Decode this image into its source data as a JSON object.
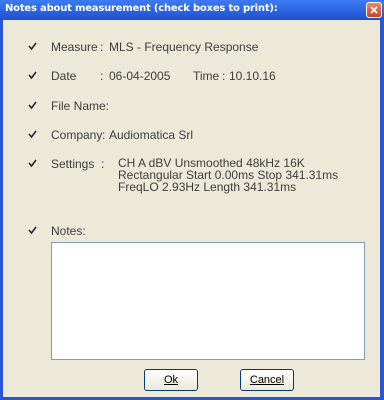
{
  "window": {
    "title": "Notes about measurement (check boxes to print):"
  },
  "fields": {
    "measure": {
      "label": "Measure",
      "value": "MLS - Frequency Response",
      "checked": true
    },
    "date": {
      "label": "Date",
      "value": "06-04-2005",
      "time_label": "Time",
      "time_value": "10.10.16",
      "checked": true
    },
    "file_name": {
      "label": "File Name:",
      "checked": true
    },
    "company": {
      "label": "Company",
      "value": "Audiomatica Srl",
      "checked": true
    },
    "settings": {
      "label": "Settings",
      "lines": [
        "CH A   dBV   Unsmoothed   48kHz   16K",
        "Rectangular   Start 0.00ms   Stop 341.31ms",
        "FreqLO 2.93Hz   Length 341.31ms"
      ],
      "checked": true
    },
    "notes": {
      "label": "Notes:",
      "value": "",
      "checked": true
    }
  },
  "buttons": {
    "ok": "Ok",
    "cancel": "Cancel"
  },
  "colors": {
    "title_bar": "#2458d8",
    "dialog_bg": "#ece9d8",
    "close_button": "#d5582f"
  }
}
